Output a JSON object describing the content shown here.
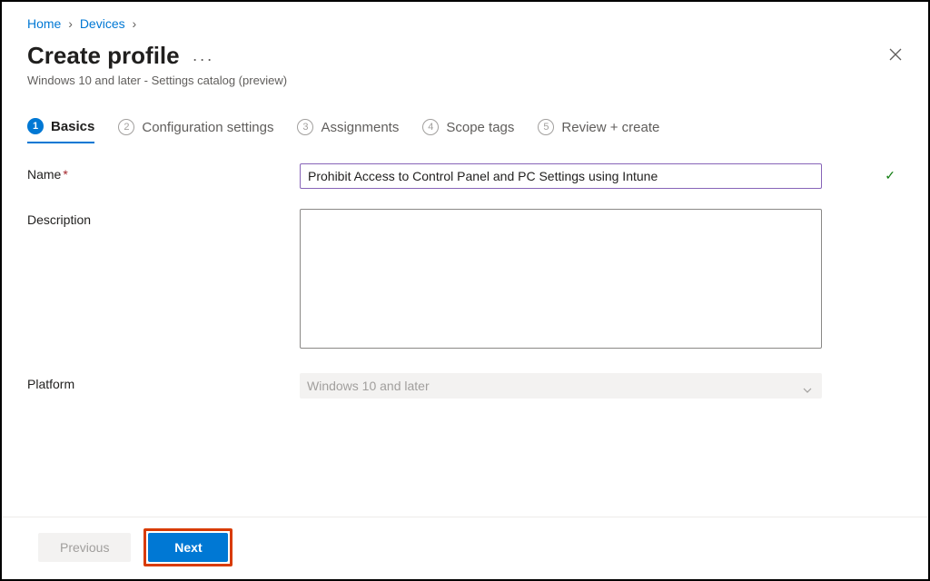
{
  "breadcrumb": {
    "home": "Home",
    "devices": "Devices"
  },
  "header": {
    "title": "Create profile",
    "subtitle": "Windows 10 and later - Settings catalog (preview)"
  },
  "tabs": [
    {
      "num": "1",
      "label": "Basics"
    },
    {
      "num": "2",
      "label": "Configuration settings"
    },
    {
      "num": "3",
      "label": "Assignments"
    },
    {
      "num": "4",
      "label": "Scope tags"
    },
    {
      "num": "5",
      "label": "Review + create"
    }
  ],
  "form": {
    "name_label": "Name",
    "name_value": "Prohibit Access to Control Panel and PC Settings using Intune",
    "description_label": "Description",
    "description_value": "",
    "platform_label": "Platform",
    "platform_value": "Windows 10 and later"
  },
  "footer": {
    "previous": "Previous",
    "next": "Next"
  }
}
